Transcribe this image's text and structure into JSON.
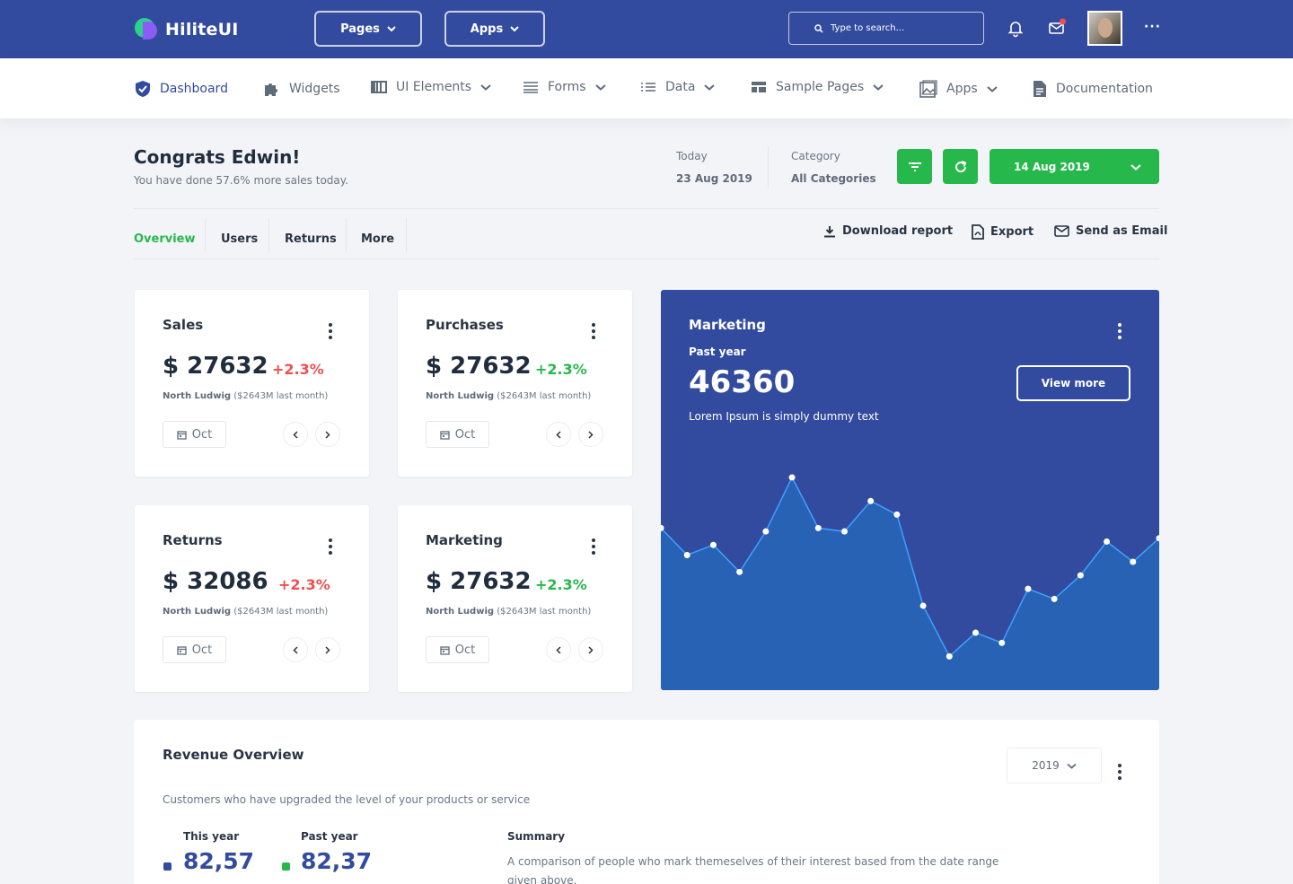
{
  "topbar": {
    "brand": "HiliteUI",
    "pages_label": "Pages",
    "apps_label": "Apps",
    "search_placeholder": "Type to search...",
    "more_label": "···"
  },
  "nav": {
    "items": [
      {
        "label": "Dashboard",
        "icon": "shield-check-icon",
        "active": true
      },
      {
        "label": "Widgets",
        "icon": "puzzle-icon"
      },
      {
        "label": "UI Elements",
        "icon": "columns-icon",
        "dropdown": true
      },
      {
        "label": "Forms",
        "icon": "form-lines-icon",
        "dropdown": true
      },
      {
        "label": "Data",
        "icon": "list-icon",
        "dropdown": true
      },
      {
        "label": "Sample Pages",
        "icon": "layout-icon",
        "dropdown": true
      },
      {
        "label": "Apps",
        "icon": "images-icon",
        "dropdown": true
      },
      {
        "label": "Documentation",
        "icon": "document-icon"
      }
    ]
  },
  "header": {
    "title": "Congrats Edwin!",
    "subtitle": "You have done 57.6% more sales today.",
    "today_label": "Today",
    "today_value": "23 Aug 2019",
    "category_label": "Category",
    "category_value": "All Categories",
    "date_button": "14 Aug 2019"
  },
  "tabs": [
    "Overview",
    "Users",
    "Returns",
    "More"
  ],
  "actions": {
    "download": "Download report",
    "export": "Export",
    "email": "Send as Email"
  },
  "cards": [
    {
      "title": "Sales",
      "value": "$ 27632",
      "delta": "+2.3%",
      "delta_color": "#ef4f4f",
      "region": "North Ludwig",
      "note": "($2643M last month)",
      "month": "Oct"
    },
    {
      "title": "Purchases",
      "value": "$ 27632",
      "delta": "+2.3%",
      "delta_color": "#27b84c",
      "region": "North Ludwig",
      "note": "($2643M last month)",
      "month": "Oct"
    },
    {
      "title": "Returns",
      "value": "$ 32086",
      "delta": "+2.3%",
      "delta_color": "#ef4f4f",
      "region": "North Ludwig",
      "note": "($2643M last month)",
      "month": "Oct"
    },
    {
      "title": "Marketing",
      "value": "$ 27632",
      "delta": "+2.3%",
      "delta_color": "#27b84c",
      "region": "North Ludwig",
      "note": "($2643M last month)",
      "month": "Oct"
    }
  ],
  "marketing": {
    "title": "Marketing",
    "period": "Past year",
    "value": "46360",
    "description": "Lorem Ipsum is simply dummy text",
    "button": "View more"
  },
  "chart_data": {
    "type": "area",
    "series": [
      {
        "values": [
          48,
          40,
          43,
          35,
          47,
          63,
          48,
          47,
          56,
          52,
          25,
          10,
          17,
          14,
          30,
          27,
          34,
          44,
          38,
          45
        ]
      }
    ],
    "ylim": [
      0,
      80
    ],
    "grid": false
  },
  "revenue": {
    "title": "Revenue Overview",
    "year": "2019",
    "description": "Customers who have upgraded the level of your products or service",
    "this_year_label": "This year",
    "this_year_value": "82,57",
    "past_year_label": "Past year",
    "past_year_value": "82,37",
    "summary_title": "Summary",
    "summary_text": "A comparison of people who mark themeselves of their interest based from the date range given above."
  },
  "colors": {
    "brand": "#324b9f",
    "success": "#27b84c",
    "danger": "#ef4f4f",
    "area_fill": "#2862b5",
    "area_line": "#3fa0ff"
  }
}
